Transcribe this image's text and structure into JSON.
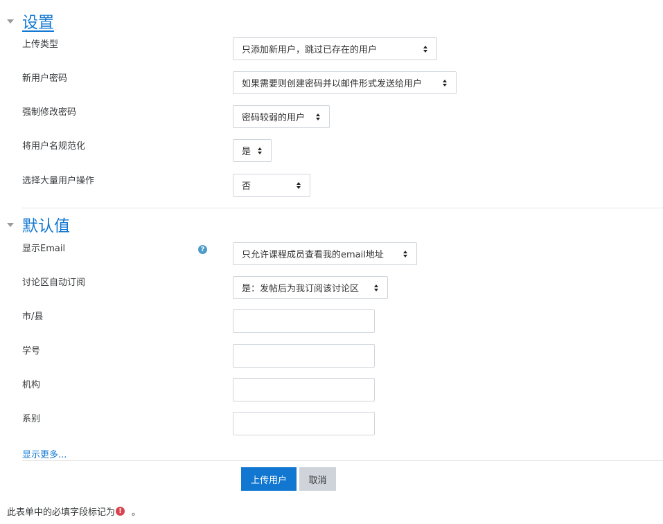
{
  "settings_section": {
    "title": "设置",
    "fields": {
      "upload_type": {
        "label": "上传类型",
        "value": "只添加新用户，跳过已存在的用户"
      },
      "new_user_password": {
        "label": "新用户密码",
        "value": "如果需要则创建密码并以邮件形式发送给用户"
      },
      "force_password_change": {
        "label": "强制修改密码",
        "value": "密码较弱的用户"
      },
      "standardise_usernames": {
        "label": "将用户名规范化",
        "value": "是"
      },
      "bulk_user_action": {
        "label": "选择大量用户操作",
        "value": "否"
      }
    }
  },
  "defaults_section": {
    "title": "默认值",
    "fields": {
      "display_email": {
        "label": "显示Email",
        "value": "只允许课程成员查看我的email地址"
      },
      "forum_autosubscribe": {
        "label": "讨论区自动订阅",
        "value": "是：发帖后为我订阅该讨论区"
      },
      "city": {
        "label": "市/县",
        "value": ""
      },
      "id_number": {
        "label": "学号",
        "value": ""
      },
      "institution": {
        "label": "机构",
        "value": ""
      },
      "department": {
        "label": "系别",
        "value": ""
      }
    },
    "show_more": "显示更多..."
  },
  "actions": {
    "submit_label": "上传用户",
    "cancel_label": "取消"
  },
  "footer": {
    "required_note": "此表单中的必填字段标记为",
    "required_icon_glyph": "!",
    "tail": "。"
  },
  "icons": {
    "help_glyph": "?"
  },
  "colors": {
    "accent": "#1177d1",
    "cancel_bg": "#ced4da",
    "required": "#d9434e",
    "help": "#4e9bc8"
  }
}
